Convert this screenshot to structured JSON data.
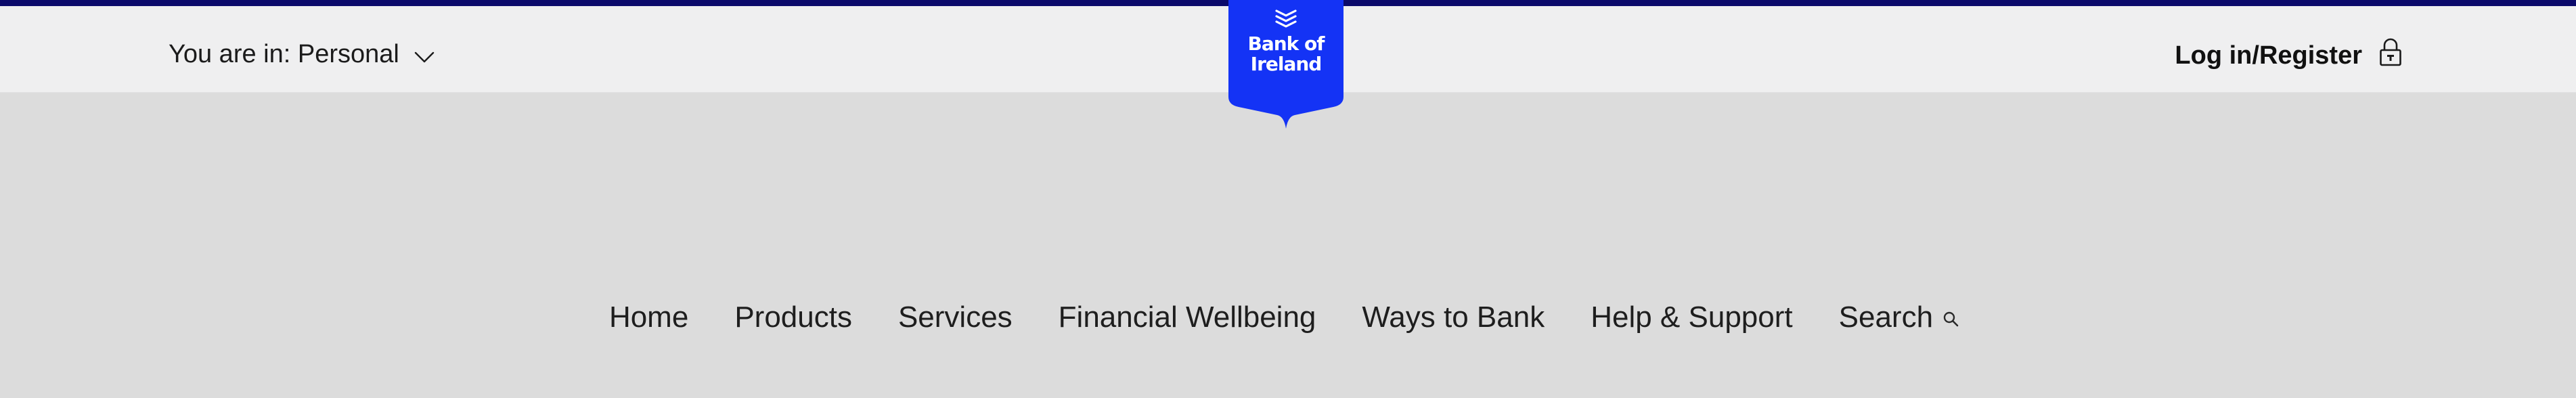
{
  "utility": {
    "segment_prefix": "You are in:",
    "segment_value": "Personal",
    "login_label": "Log in/Register"
  },
  "brand": {
    "line1": "Bank of",
    "line2": "Ireland",
    "color": "#1433f5",
    "accent_bar_color": "#0b0a6b"
  },
  "nav": {
    "items": [
      {
        "label": "Home"
      },
      {
        "label": "Products"
      },
      {
        "label": "Services"
      },
      {
        "label": "Financial Wellbeing"
      },
      {
        "label": "Ways to Bank"
      },
      {
        "label": "Help & Support"
      },
      {
        "label": "Search",
        "icon": "search-icon"
      }
    ]
  },
  "icons": {
    "segment_toggle": "chevron-down-icon",
    "login": "lock-icon",
    "brand_mark": "stacked-chevrons-icon"
  }
}
